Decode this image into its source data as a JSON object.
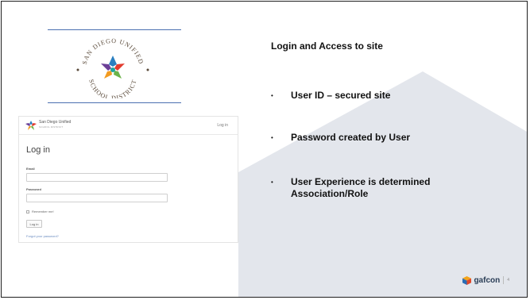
{
  "slide": {
    "heading": "Login and Access to site",
    "bullets": [
      {
        "text": "User ID – secured site"
      },
      {
        "text": "Password created by User"
      },
      {
        "text_line1": "User Experience is determined",
        "text_line2": "Association/Role"
      }
    ],
    "bullet_glyph": "•"
  },
  "logo": {
    "arc_text": "SAN DIEGO UNIFIED SCHOOL DISTRICT",
    "star_colors": [
      "#2a7fc0",
      "#e23b2e",
      "#f29b20",
      "#6bb34a",
      "#6b3f97",
      "#1fa6a0"
    ]
  },
  "login_screenshot": {
    "brand_name": "San Diego Unified",
    "brand_sub": "SCHOOL DISTRICT",
    "header_link": "Log in",
    "title": "Log in",
    "email_label": "Email",
    "password_label": "Password",
    "remember_label": "Remember me!",
    "submit_label": "Log in",
    "forgot_link": "Forgot your password?"
  },
  "footer": {
    "brand": "gafcon",
    "page_number": "4"
  }
}
